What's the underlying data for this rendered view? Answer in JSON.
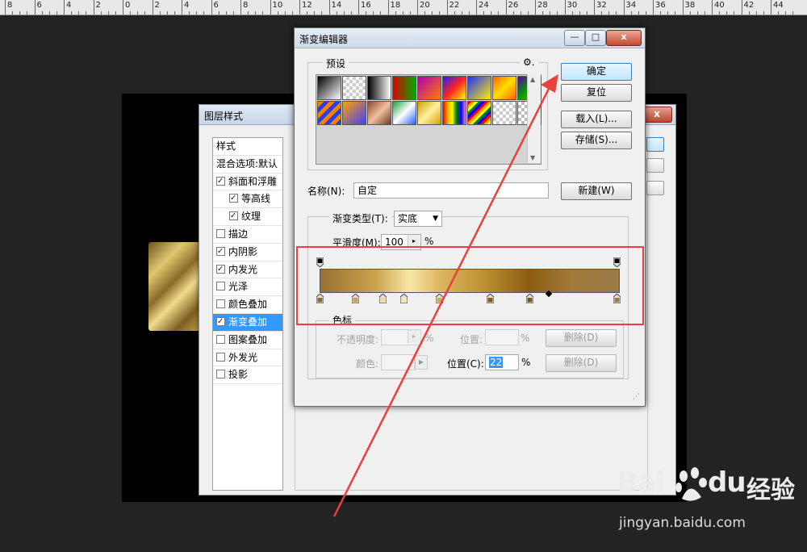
{
  "ruler": {
    "numbers": [
      "8",
      "6",
      "4",
      "2",
      "0",
      "2",
      "4",
      "6",
      "8",
      "10",
      "12",
      "14",
      "16",
      "18",
      "20",
      "22",
      "24",
      "26",
      "28",
      "30",
      "32",
      "34",
      "36",
      "38",
      "40",
      "42",
      "44"
    ]
  },
  "layer_style_dialog": {
    "title": "图层样式",
    "close_label": "x",
    "list_header": "样式",
    "blend_options": "混合选项:默认",
    "items": [
      {
        "label": "斜面和浮雕",
        "checked": true,
        "sub": false
      },
      {
        "label": "等高线",
        "checked": true,
        "sub": true
      },
      {
        "label": "纹理",
        "checked": true,
        "sub": true
      },
      {
        "label": "描边",
        "checked": false,
        "sub": false
      },
      {
        "label": "内阴影",
        "checked": true,
        "sub": false
      },
      {
        "label": "内发光",
        "checked": true,
        "sub": false
      },
      {
        "label": "光泽",
        "checked": false,
        "sub": false
      },
      {
        "label": "颜色叠加",
        "checked": false,
        "sub": false
      },
      {
        "label": "渐变叠加",
        "checked": true,
        "sub": false,
        "selected": true
      },
      {
        "label": "图案叠加",
        "checked": false,
        "sub": false
      },
      {
        "label": "外发光",
        "checked": false,
        "sub": false
      },
      {
        "label": "投影",
        "checked": false,
        "sub": false
      }
    ]
  },
  "gradient_editor": {
    "title": "渐变编辑器",
    "min_label": "—",
    "max_label": "□",
    "close_label": "x",
    "presets_label": "预设",
    "gear_label": "⚙.",
    "ok_label": "确定",
    "reset_label": "复位",
    "load_label": "载入(L)...",
    "save_label": "存储(S)...",
    "name_label": "名称(N):",
    "name_value": "自定",
    "new_label": "新建(W)",
    "type_label": "渐变类型(T):",
    "type_value": "实底",
    "smooth_label": "平滑度(M):",
    "smooth_value": "100",
    "percent": "%",
    "stops_group_label": "色标",
    "opacity_label": "不透明度:",
    "position_label_top": "位置:",
    "delete_label": "删除(D)",
    "color_label": "颜色:",
    "position_label": "位置(C):",
    "position_value": "22"
  },
  "watermark": {
    "logo": "Bai",
    "logo_tail": "du",
    "cn": "经验",
    "url": "jingyan.baidu.com"
  },
  "colors": {
    "accent_red": "#e8413e",
    "selection_blue": "#3399ff"
  }
}
